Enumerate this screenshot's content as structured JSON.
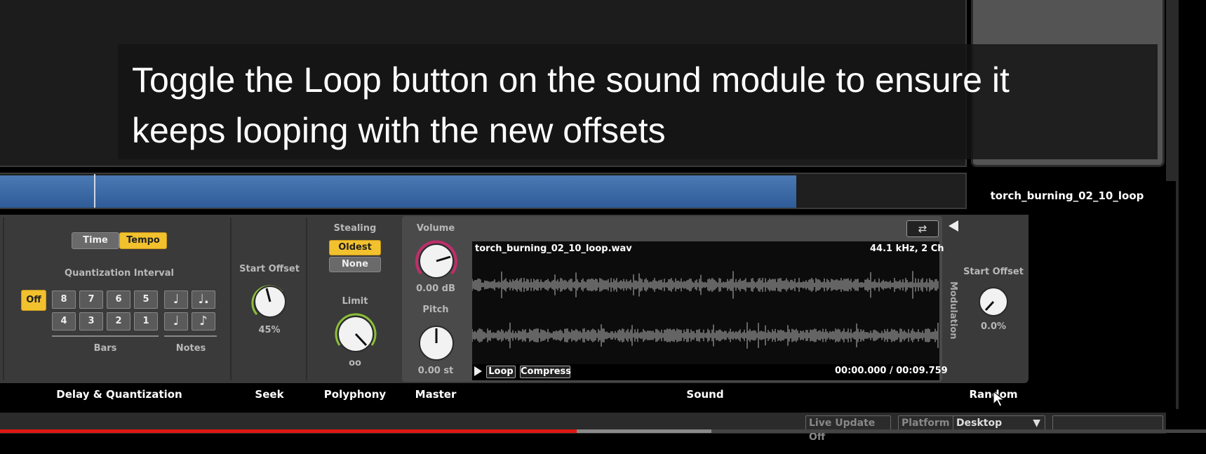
{
  "caption": {
    "line1": "Toggle the Loop button on the sound module to ensure it",
    "line2": "keeps looping with the new offsets"
  },
  "sound_name": "torch_burning_02_10_loop",
  "delay_quantization": {
    "mode_buttons": [
      "Time",
      "Tempo"
    ],
    "selected_mode": "Tempo",
    "interval_label": "Quantization Interval",
    "off_label": "Off",
    "bars_top": [
      "8",
      "7",
      "6",
      "5"
    ],
    "bars_bottom": [
      "4",
      "3",
      "2",
      "1"
    ],
    "notes_top": [
      "♩",
      "♩."
    ],
    "notes_bottom": [
      "♩",
      "♪"
    ],
    "bars_label": "Bars",
    "notes_label": "Notes",
    "section": "Delay & Quantization"
  },
  "seek": {
    "label": "Start Offset",
    "value": "45%",
    "level": 0.45,
    "section": "Seek"
  },
  "polyphony": {
    "stealing_label": "Stealing",
    "options": [
      "Oldest",
      "None"
    ],
    "selected": "Oldest",
    "limit_label": "Limit",
    "limit_value": "oo",
    "section": "Polyphony"
  },
  "master": {
    "volume_label": "Volume",
    "volume_value": "0.00 dB",
    "pitch_label": "Pitch",
    "pitch_value": "0.00 st",
    "section": "Master"
  },
  "sound": {
    "filename": "torch_burning_02_10_loop.wav",
    "format": "44.1 kHz, 2 Ch",
    "loop_label": "Loop",
    "compress_label": "Compress",
    "time": "00:00.000 / 00:09.759",
    "modulation_label": "Modulation",
    "section": "Sound"
  },
  "random": {
    "label": "Start Offset",
    "value": "0.0%",
    "section": "Random"
  },
  "statusbar": {
    "live_update": "Live Update Off",
    "platform_label": "Platform",
    "platform_value": "Desktop"
  },
  "video_progress": 0.48
}
